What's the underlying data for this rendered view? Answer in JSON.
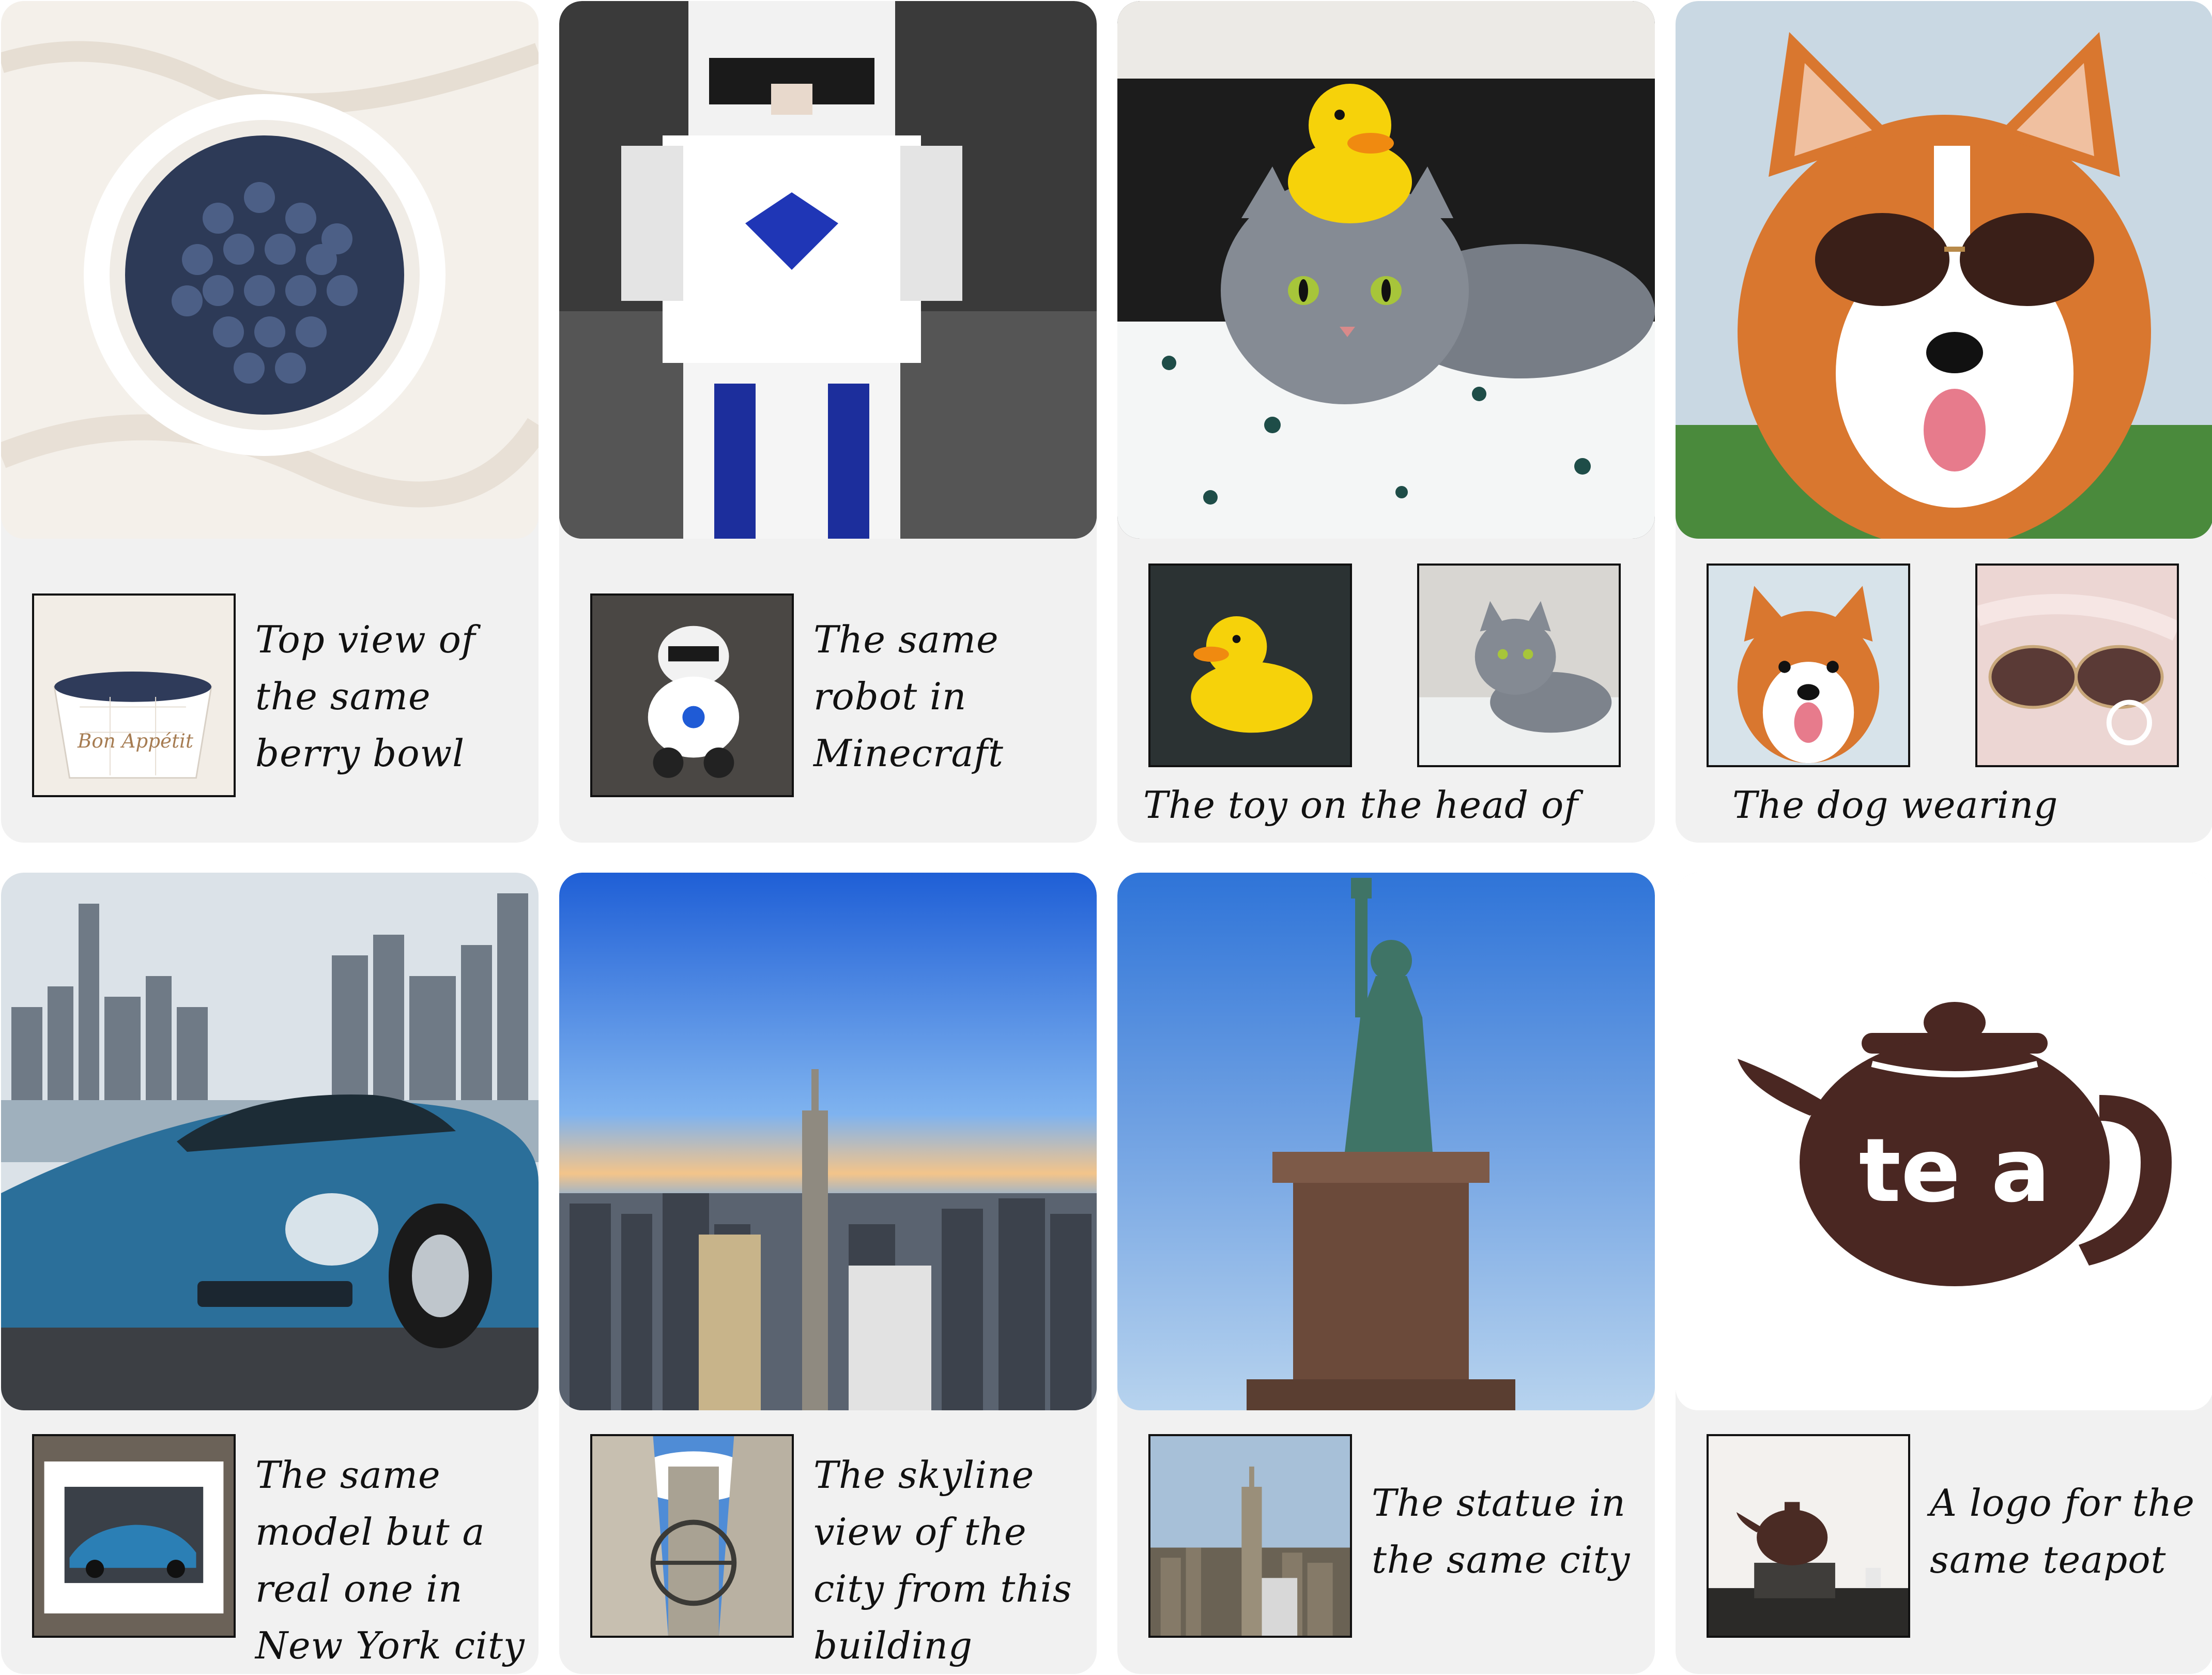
{
  "cards": [
    {
      "caption": "Top view of the same berry bowl",
      "thumb_text": "Bon Appétit"
    },
    {
      "caption": "The same robot in Minecraft"
    },
    {
      "caption": "The toy on the head of the cat"
    },
    {
      "caption": "The dog wearing sunglasses"
    },
    {
      "caption": "The same model but a real one in New York city"
    },
    {
      "caption": "The skyline view of the city from this building"
    },
    {
      "caption": "The statue in the same city"
    },
    {
      "caption": "A logo for the same teapot",
      "logo_text": "te a"
    }
  ],
  "colors": {
    "card_bg": "#f1f1f1",
    "teapot_brown": "#4a2722",
    "sky_blue": "#3a7fe0",
    "car_blue": "#2b6f9a"
  }
}
